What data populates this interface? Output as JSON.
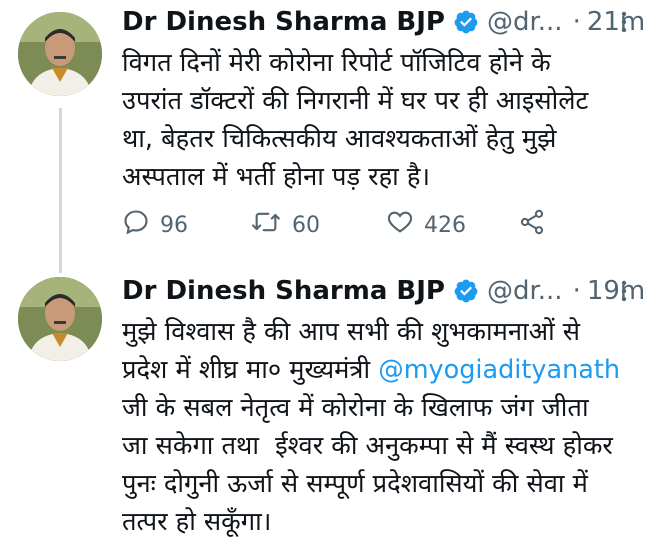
{
  "colors": {
    "accent": "#1d9bf0",
    "verified": "#1d9bf0",
    "muted": "#536471",
    "text": "#0f1419",
    "thread_line": "#cfd9de"
  },
  "tweets": [
    {
      "author_name": "Dr Dinesh Sharma BJP",
      "handle": "@dr...",
      "separator": "·",
      "time": "21m",
      "verified_icon": "verified-badge-icon",
      "text": "विगत दिनों मेरी कोरोना रिपोर्ट पॉजिटिव होने के\nउपरांत डॉक्टरों की निगरानी में घर पर ही आइसोलेट\nथा, बेहतर चिकित्सकीय आवश्यकताओं हेतु मुझे\nअस्पताल में भर्ती होना पड़ रहा है।",
      "replies": "96",
      "retweets": "60",
      "likes": "426"
    },
    {
      "author_name": "Dr Dinesh Sharma BJP",
      "handle": "@dr...",
      "separator": "·",
      "time": "19m",
      "verified_icon": "verified-badge-icon",
      "text_before_mention": "मुझे विश्वास है की आप सभी की शुभकामनाओं से\nप्रदेश में शीघ्र मा० मुख्यमंत्री ",
      "mention": "@myogiadityanath",
      "text_after_mention": "\nजी के सबल नेतृत्व में कोरोना के खिलाफ जंग जीता\nजा सकेगा तथा  ईश्वर की अनुकम्पा से मैं स्वस्थ होकर\nपुनः दोगुनी ऊर्जा से सम्पूर्ण प्रदेशवासियों की सेवा में\nतत्पर हो सकूँगा।"
    }
  ]
}
